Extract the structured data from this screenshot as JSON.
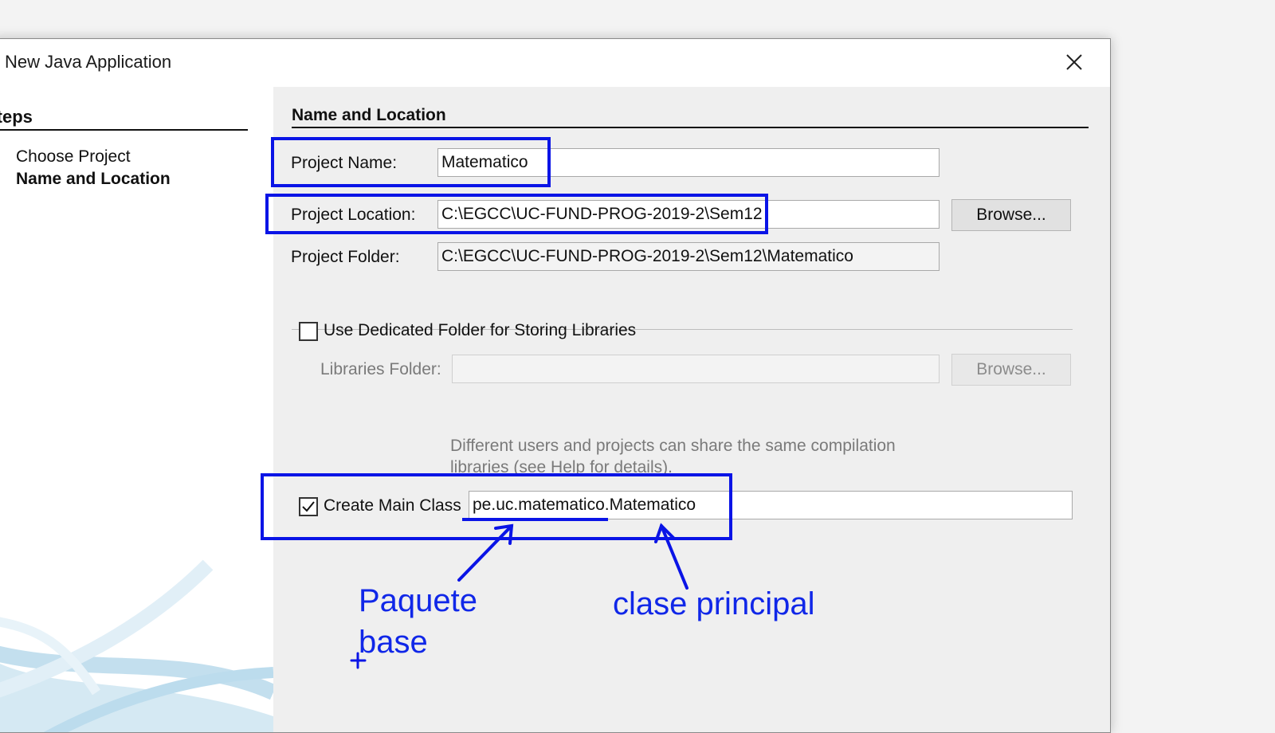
{
  "dialog": {
    "title": "New Java Application"
  },
  "steps": {
    "title": "Steps",
    "items": [
      {
        "label": "Choose Project",
        "current": false
      },
      {
        "label": "Name and Location",
        "current": true
      }
    ]
  },
  "form": {
    "section_title": "Name and Location",
    "project_name": {
      "label": "Project Name:",
      "value": "Matematico"
    },
    "project_location": {
      "label": "Project Location:",
      "value": "C:\\EGCC\\UC-FUND-PROG-2019-2\\Sem12",
      "browse_label": "Browse..."
    },
    "project_folder": {
      "label": "Project Folder:",
      "value": "C:\\EGCC\\UC-FUND-PROG-2019-2\\Sem12\\Matematico"
    },
    "dedicated_folder": {
      "label": "Use Dedicated Folder for Storing Libraries",
      "checked": false
    },
    "libraries_folder": {
      "label": "Libraries Folder:",
      "value": "",
      "browse_label": "Browse..."
    },
    "note": {
      "line1": "Different users and projects can share the same compilation",
      "line2": "libraries (see Help for details)."
    },
    "main_class": {
      "label": "Create Main Class",
      "checked": true,
      "value": "pe.uc.matematico.Matematico"
    }
  },
  "annotations": {
    "package_line1": "Paquete",
    "package_line2": "base",
    "main_class": "clase principal",
    "color": "#0a14e6"
  }
}
